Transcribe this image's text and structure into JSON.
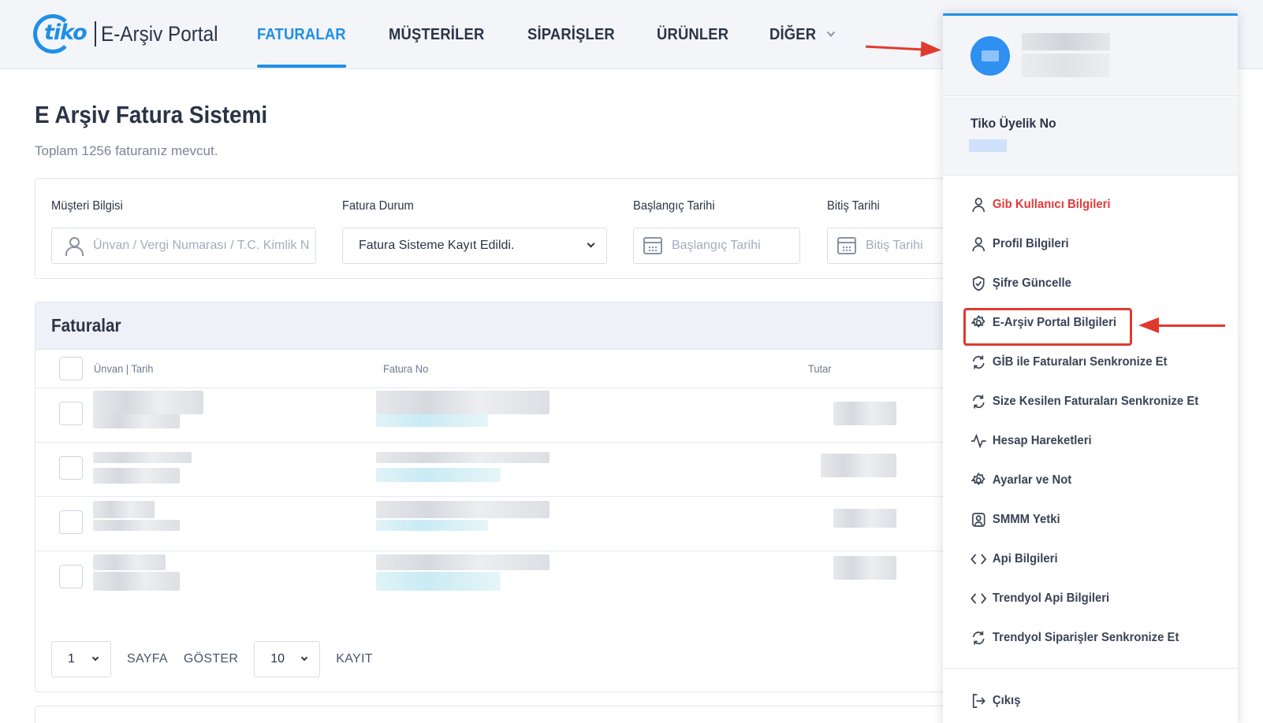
{
  "brand": {
    "logo_mark": "tiko",
    "logo_text": "E-Arşiv Portal",
    "accent": "#1f8fe6"
  },
  "nav": {
    "items": [
      {
        "label": "FATURALAR",
        "active": true
      },
      {
        "label": "MÜŞTERİLER"
      },
      {
        "label": "SİPARİŞLER"
      },
      {
        "label": "ÜRÜNLER"
      },
      {
        "label": "DİĞER",
        "dropdown": true
      }
    ]
  },
  "main": {
    "title": "E Arşiv Fatura Sistemi",
    "subtitle": "Toplam 1256 faturanız mevcut."
  },
  "filters": {
    "customer": {
      "label": "Müşteri Bilgisi",
      "placeholder": "Ünvan / Vergi Numarası / T.C. Kimlik N"
    },
    "status": {
      "label": "Fatura Durum",
      "value": "Fatura Sisteme Kayıt Edildi."
    },
    "start": {
      "label": "Başlangıç Tarihi",
      "placeholder": "Başlangıç Tarihi"
    },
    "end": {
      "label": "Bitiş Tarihi",
      "placeholder": "Bitiş Tarihi"
    }
  },
  "table": {
    "title": "Faturalar",
    "columns": [
      "Ünvan | Tarih",
      "Fatura No",
      "Tutar"
    ],
    "row_count": 4
  },
  "pager": {
    "page": "1",
    "page_label": "SAYFA",
    "show_label": "GÖSTER",
    "per_page": "10",
    "record_label": "KAYIT"
  },
  "user_menu": {
    "member_label": "Tiko Üyelik No",
    "items": [
      {
        "label": "Gib Kullanıcı Bilgileri",
        "icon": "user-icon",
        "color": "#e23a3a"
      },
      {
        "label": "Profil Bilgileri",
        "icon": "user-icon"
      },
      {
        "label": "Şifre Güncelle",
        "icon": "shield-check-icon"
      },
      {
        "label": "E-Arşiv Portal Bilgileri",
        "icon": "gear-icon",
        "highlighted": true
      },
      {
        "label": "GİB ile Faturaları Senkronize Et",
        "icon": "sync-icon"
      },
      {
        "label": "Size Kesilen Faturaları Senkronize Et",
        "icon": "sync-icon"
      },
      {
        "label": "Hesap Hareketleri",
        "icon": "activity-icon"
      },
      {
        "label": "Ayarlar ve Not",
        "icon": "gear-icon"
      },
      {
        "label": "SMMM Yetki",
        "icon": "user-badge-icon"
      },
      {
        "label": "Api Bilgileri",
        "icon": "code-icon"
      },
      {
        "label": "Trendyol Api Bilgileri",
        "icon": "code-icon"
      },
      {
        "label": "Trendyol Siparişler Senkronize Et",
        "icon": "sync-icon"
      }
    ],
    "logout_label": "Çıkış",
    "highlight_color": "#e03a2f"
  }
}
